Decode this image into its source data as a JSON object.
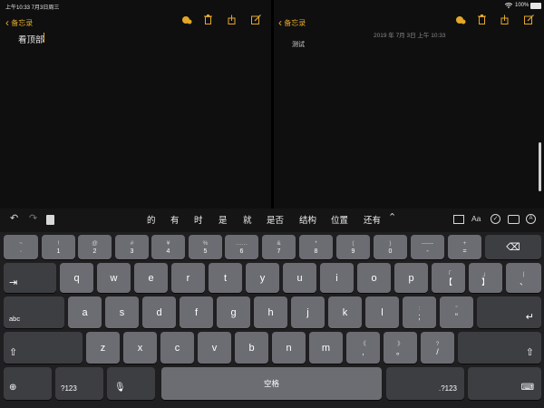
{
  "status_bar": {
    "time_date": "上午10:33  7月3日周三",
    "battery": "100%"
  },
  "left_pane": {
    "back_label": "备忘录",
    "note_text": "看顶部"
  },
  "right_pane": {
    "back_label": "备忘录",
    "timestamp": "2019 年 7月 3日 上午 10:33",
    "note_text": "测试"
  },
  "toolbar": {
    "suggestions": [
      "的",
      "有",
      "时",
      "是",
      "就",
      "是否",
      "结构",
      "位置",
      "还有"
    ]
  },
  "keyboard": {
    "row1": [
      {
        "top": "~",
        "bottom": "·"
      },
      {
        "top": "!",
        "bottom": "1"
      },
      {
        "top": "@",
        "bottom": "2"
      },
      {
        "top": "#",
        "bottom": "3"
      },
      {
        "top": "¥",
        "bottom": "4"
      },
      {
        "top": "%",
        "bottom": "5"
      },
      {
        "top": "……",
        "bottom": "6"
      },
      {
        "top": "&",
        "bottom": "7"
      },
      {
        "top": "*",
        "bottom": "8"
      },
      {
        "top": "(",
        "bottom": "9"
      },
      {
        "top": ")",
        "bottom": "0"
      },
      {
        "top": "——",
        "bottom": "-"
      },
      {
        "top": "+",
        "bottom": "="
      }
    ],
    "row2": [
      "q",
      "w",
      "e",
      "r",
      "t",
      "y",
      "u",
      "i",
      "o",
      "p"
    ],
    "row2_punct": [
      {
        "top": "「",
        "bottom": "【"
      },
      {
        "top": "」",
        "bottom": "】"
      },
      {
        "top": "|",
        "bottom": "、"
      }
    ],
    "row3": [
      "a",
      "s",
      "d",
      "f",
      "g",
      "h",
      "j",
      "k",
      "l"
    ],
    "row3_punct": [
      {
        "top": ":",
        "bottom": ";"
      },
      {
        "top": "”",
        "bottom": "“"
      }
    ],
    "row4": [
      "z",
      "x",
      "c",
      "v",
      "b",
      "n",
      "m"
    ],
    "row4_punct": [
      {
        "top": "《",
        "bottom": ","
      },
      {
        "top": "》",
        "bottom": "。"
      },
      {
        "top": "?",
        "bottom": "/"
      }
    ],
    "tab_label": "⇥",
    "caps_label": "abc",
    "num_label": "?123",
    "space_label": "空格",
    "num_label_right": ".?123"
  },
  "colors": {
    "accent": "#e3a828",
    "key": "#6c6d72",
    "key_dark": "#3d3e42",
    "background": "#0f0f10"
  }
}
